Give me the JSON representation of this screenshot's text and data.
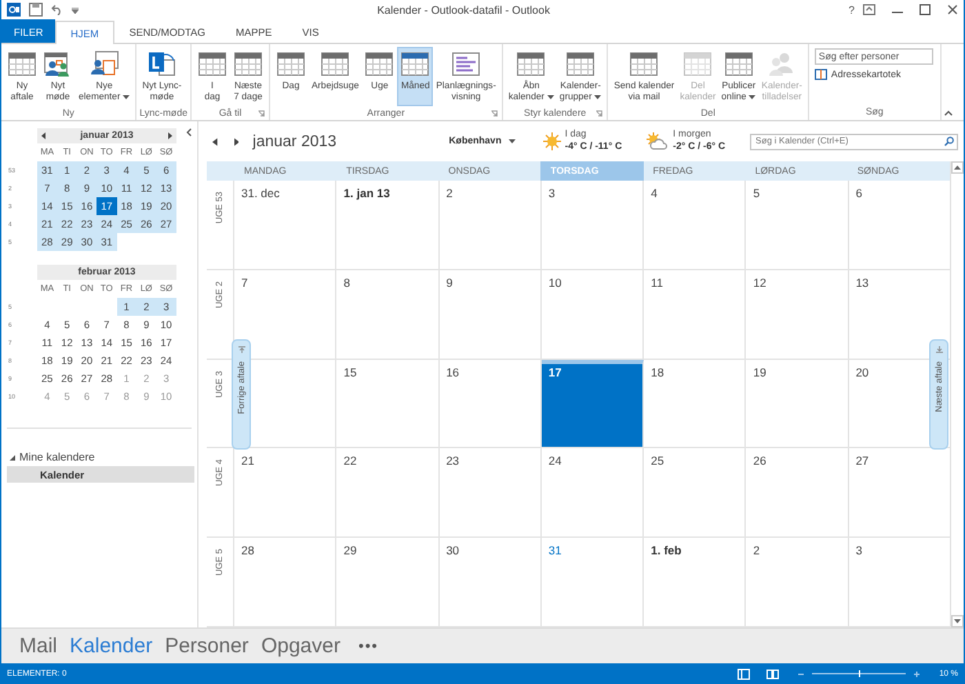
{
  "window": {
    "title": "Kalender - Outlook-datafil - Outlook",
    "help": "?"
  },
  "ribbon_tabs": [
    {
      "label": "FILER",
      "kind": "file",
      "selected": false
    },
    {
      "label": "HJEM",
      "kind": "tab",
      "selected": true
    },
    {
      "label": "SEND/MODTAG",
      "kind": "tab",
      "selected": false
    },
    {
      "label": "MAPPE",
      "kind": "tab",
      "selected": false
    },
    {
      "label": "VIS",
      "kind": "tab",
      "selected": false
    }
  ],
  "ribbon_groups": [
    {
      "label": "Ny",
      "launcher": false,
      "buttons": [
        {
          "lines": [
            "Ny",
            "aftale"
          ],
          "dropdown": false,
          "selected": false,
          "disabled": false
        },
        {
          "lines": [
            "Nyt",
            "møde"
          ],
          "dropdown": false,
          "selected": false,
          "disabled": false
        },
        {
          "lines": [
            "Nye",
            "elementer"
          ],
          "dropdown": true,
          "selected": false,
          "disabled": false
        }
      ]
    },
    {
      "label": "Lync-møde",
      "launcher": false,
      "buttons": [
        {
          "lines": [
            "Nyt Lync-",
            "møde"
          ],
          "dropdown": false,
          "selected": false,
          "disabled": false
        }
      ]
    },
    {
      "label": "Gå til",
      "launcher": true,
      "buttons": [
        {
          "lines": [
            "I",
            "dag"
          ],
          "dropdown": false,
          "selected": false,
          "disabled": false
        },
        {
          "lines": [
            "Næste",
            "7 dage"
          ],
          "dropdown": false,
          "selected": false,
          "disabled": false
        }
      ]
    },
    {
      "label": "Arranger",
      "launcher": true,
      "buttons": [
        {
          "lines": [
            "Dag"
          ],
          "dropdown": false,
          "selected": false,
          "disabled": false
        },
        {
          "lines": [
            "Arbejdsuge"
          ],
          "dropdown": false,
          "selected": false,
          "disabled": false
        },
        {
          "lines": [
            "Uge"
          ],
          "dropdown": false,
          "selected": false,
          "disabled": false
        },
        {
          "lines": [
            "Måned"
          ],
          "dropdown": false,
          "selected": true,
          "disabled": false
        },
        {
          "lines": [
            "Planlægnings-",
            "visning"
          ],
          "dropdown": false,
          "selected": false,
          "disabled": false
        }
      ]
    },
    {
      "label": "Styr kalendere",
      "launcher": true,
      "buttons": [
        {
          "lines": [
            "Åbn",
            "kalender"
          ],
          "dropdown": true,
          "selected": false,
          "disabled": false
        },
        {
          "lines": [
            "Kalender-",
            "grupper"
          ],
          "dropdown": true,
          "selected": false,
          "disabled": false
        }
      ]
    },
    {
      "label": "Del",
      "launcher": false,
      "buttons": [
        {
          "lines": [
            "Send kalender",
            "via mail"
          ],
          "dropdown": false,
          "selected": false,
          "disabled": false
        },
        {
          "lines": [
            "Del",
            "kalender"
          ],
          "dropdown": false,
          "selected": false,
          "disabled": true
        },
        {
          "lines": [
            "Publicer",
            "online"
          ],
          "dropdown": true,
          "selected": false,
          "disabled": false
        },
        {
          "lines": [
            "Kalender-",
            "tilladelser"
          ],
          "dropdown": false,
          "selected": false,
          "disabled": true
        }
      ]
    }
  ],
  "search_group": {
    "label": "Søg",
    "placeholder": "Søg efter personer",
    "address_book": "Adressekartotek"
  },
  "mini_calendars": [
    {
      "title": "januar 2013",
      "arrows": true,
      "weekdays": [
        "MA",
        "TI",
        "ON",
        "TO",
        "FR",
        "LØ",
        "SØ"
      ],
      "weeks": [
        {
          "number": "53",
          "days": [
            {
              "label": "31",
              "in_view": true,
              "today": false,
              "dim": false
            },
            {
              "label": "1",
              "in_view": true,
              "today": false,
              "dim": false
            },
            {
              "label": "2",
              "in_view": true,
              "today": false,
              "dim": false
            },
            {
              "label": "3",
              "in_view": true,
              "today": false,
              "dim": false
            },
            {
              "label": "4",
              "in_view": true,
              "today": false,
              "dim": false
            },
            {
              "label": "5",
              "in_view": true,
              "today": false,
              "dim": false
            },
            {
              "label": "6",
              "in_view": true,
              "today": false,
              "dim": false
            }
          ]
        },
        {
          "number": "2",
          "days": [
            {
              "label": "7",
              "in_view": true,
              "today": false,
              "dim": false
            },
            {
              "label": "8",
              "in_view": true,
              "today": false,
              "dim": false
            },
            {
              "label": "9",
              "in_view": true,
              "today": false,
              "dim": false
            },
            {
              "label": "10",
              "in_view": true,
              "today": false,
              "dim": false
            },
            {
              "label": "11",
              "in_view": true,
              "today": false,
              "dim": false
            },
            {
              "label": "12",
              "in_view": true,
              "today": false,
              "dim": false
            },
            {
              "label": "13",
              "in_view": true,
              "today": false,
              "dim": false
            }
          ]
        },
        {
          "number": "3",
          "days": [
            {
              "label": "14",
              "in_view": true,
              "today": false,
              "dim": false
            },
            {
              "label": "15",
              "in_view": true,
              "today": false,
              "dim": false
            },
            {
              "label": "16",
              "in_view": true,
              "today": false,
              "dim": false
            },
            {
              "label": "17",
              "in_view": true,
              "today": true,
              "dim": false
            },
            {
              "label": "18",
              "in_view": true,
              "today": false,
              "dim": false
            },
            {
              "label": "19",
              "in_view": true,
              "today": false,
              "dim": false
            },
            {
              "label": "20",
              "in_view": true,
              "today": false,
              "dim": false
            }
          ]
        },
        {
          "number": "4",
          "days": [
            {
              "label": "21",
              "in_view": true,
              "today": false,
              "dim": false
            },
            {
              "label": "22",
              "in_view": true,
              "today": false,
              "dim": false
            },
            {
              "label": "23",
              "in_view": true,
              "today": false,
              "dim": false
            },
            {
              "label": "24",
              "in_view": true,
              "today": false,
              "dim": false
            },
            {
              "label": "25",
              "in_view": true,
              "today": false,
              "dim": false
            },
            {
              "label": "26",
              "in_view": true,
              "today": false,
              "dim": false
            },
            {
              "label": "27",
              "in_view": true,
              "today": false,
              "dim": false
            }
          ]
        },
        {
          "number": "5",
          "days": [
            {
              "label": "28",
              "in_view": true,
              "today": false,
              "dim": false
            },
            {
              "label": "29",
              "in_view": true,
              "today": false,
              "dim": false
            },
            {
              "label": "30",
              "in_view": true,
              "today": false,
              "dim": false
            },
            {
              "label": "31",
              "in_view": true,
              "today": false,
              "dim": false
            }
          ]
        }
      ]
    },
    {
      "title": "februar 2013",
      "arrows": false,
      "weekdays": [
        "MA",
        "TI",
        "ON",
        "TO",
        "FR",
        "LØ",
        "SØ"
      ],
      "weeks": [
        {
          "number": "5",
          "days": [
            {
              "label": "1",
              "in_view": true,
              "today": false,
              "dim": false
            },
            {
              "label": "2",
              "in_view": true,
              "today": false,
              "dim": false
            },
            {
              "label": "3",
              "in_view": true,
              "today": false,
              "dim": false
            }
          ]
        },
        {
          "number": "6",
          "days": [
            {
              "label": "4",
              "in_view": false,
              "today": false,
              "dim": false
            },
            {
              "label": "5",
              "in_view": false,
              "today": false,
              "dim": false
            },
            {
              "label": "6",
              "in_view": false,
              "today": false,
              "dim": false
            },
            {
              "label": "7",
              "in_view": false,
              "today": false,
              "dim": false
            },
            {
              "label": "8",
              "in_view": false,
              "today": false,
              "dim": false
            },
            {
              "label": "9",
              "in_view": false,
              "today": false,
              "dim": false
            },
            {
              "label": "10",
              "in_view": false,
              "today": false,
              "dim": false
            }
          ]
        },
        {
          "number": "7",
          "days": [
            {
              "label": "11",
              "in_view": false,
              "today": false,
              "dim": false
            },
            {
              "label": "12",
              "in_view": false,
              "today": false,
              "dim": false
            },
            {
              "label": "13",
              "in_view": false,
              "today": false,
              "dim": false
            },
            {
              "label": "14",
              "in_view": false,
              "today": false,
              "dim": false
            },
            {
              "label": "15",
              "in_view": false,
              "today": false,
              "dim": false
            },
            {
              "label": "16",
              "in_view": false,
              "today": false,
              "dim": false
            },
            {
              "label": "17",
              "in_view": false,
              "today": false,
              "dim": false
            }
          ]
        },
        {
          "number": "8",
          "days": [
            {
              "label": "18",
              "in_view": false,
              "today": false,
              "dim": false
            },
            {
              "label": "19",
              "in_view": false,
              "today": false,
              "dim": false
            },
            {
              "label": "20",
              "in_view": false,
              "today": false,
              "dim": false
            },
            {
              "label": "21",
              "in_view": false,
              "today": false,
              "dim": false
            },
            {
              "label": "22",
              "in_view": false,
              "today": false,
              "dim": false
            },
            {
              "label": "23",
              "in_view": false,
              "today": false,
              "dim": false
            },
            {
              "label": "24",
              "in_view": false,
              "today": false,
              "dim": false
            }
          ]
        },
        {
          "number": "9",
          "days": [
            {
              "label": "25",
              "in_view": false,
              "today": false,
              "dim": false
            },
            {
              "label": "26",
              "in_view": false,
              "today": false,
              "dim": false
            },
            {
              "label": "27",
              "in_view": false,
              "today": false,
              "dim": false
            },
            {
              "label": "28",
              "in_view": false,
              "today": false,
              "dim": false
            },
            {
              "label": "1",
              "in_view": false,
              "today": false,
              "dim": true
            },
            {
              "label": "2",
              "in_view": false,
              "today": false,
              "dim": true
            },
            {
              "label": "3",
              "in_view": false,
              "today": false,
              "dim": true
            }
          ]
        },
        {
          "number": "10",
          "days": [
            {
              "label": "4",
              "in_view": false,
              "today": false,
              "dim": true
            },
            {
              "label": "5",
              "in_view": false,
              "today": false,
              "dim": true
            },
            {
              "label": "6",
              "in_view": false,
              "today": false,
              "dim": true
            },
            {
              "label": "7",
              "in_view": false,
              "today": false,
              "dim": true
            },
            {
              "label": "8",
              "in_view": false,
              "today": false,
              "dim": true
            },
            {
              "label": "9",
              "in_view": false,
              "today": false,
              "dim": true
            },
            {
              "label": "10",
              "in_view": false,
              "today": false,
              "dim": true
            }
          ]
        }
      ]
    }
  ],
  "folder_pane": {
    "section": "Mine kalendere",
    "expanded": true,
    "items": [
      {
        "label": "Kalender",
        "selected": true
      }
    ]
  },
  "calendar": {
    "title": "januar 2013",
    "location": "København",
    "weather": [
      {
        "label": "I dag",
        "temps": "-4° C / -11° C",
        "kind": "sun"
      },
      {
        "label": "I morgen",
        "temps": "-2° C / -6° C",
        "kind": "partly_cloudy"
      }
    ],
    "search_placeholder": "Søg i Kalender (Ctrl+E)",
    "weekdays": [
      {
        "label": "MANDAG",
        "selected": false
      },
      {
        "label": "TIRSDAG",
        "selected": false
      },
      {
        "label": "ONSDAG",
        "selected": false
      },
      {
        "label": "TORSDAG",
        "selected": true
      },
      {
        "label": "FREDAG",
        "selected": false
      },
      {
        "label": "LØRDAG",
        "selected": false
      },
      {
        "label": "SØNDAG",
        "selected": false
      }
    ],
    "weeks": [
      {
        "label": "UGE 53",
        "days": [
          {
            "label": "31. dec",
            "bold": false,
            "today": false,
            "accent": false
          },
          {
            "label": "1. jan 13",
            "bold": true,
            "today": false,
            "accent": false
          },
          {
            "label": "2",
            "bold": false,
            "today": false,
            "accent": false
          },
          {
            "label": "3",
            "bold": false,
            "today": false,
            "accent": false
          },
          {
            "label": "4",
            "bold": false,
            "today": false,
            "accent": false
          },
          {
            "label": "5",
            "bold": false,
            "today": false,
            "accent": false
          },
          {
            "label": "6",
            "bold": false,
            "today": false,
            "accent": false
          }
        ]
      },
      {
        "label": "UGE 2",
        "days": [
          {
            "label": "7",
            "bold": false,
            "today": false,
            "accent": false
          },
          {
            "label": "8",
            "bold": false,
            "today": false,
            "accent": false
          },
          {
            "label": "9",
            "bold": false,
            "today": false,
            "accent": false
          },
          {
            "label": "10",
            "bold": false,
            "today": false,
            "accent": false
          },
          {
            "label": "11",
            "bold": false,
            "today": false,
            "accent": false
          },
          {
            "label": "12",
            "bold": false,
            "today": false,
            "accent": false
          },
          {
            "label": "13",
            "bold": false,
            "today": false,
            "accent": false
          }
        ]
      },
      {
        "label": "UGE 3",
        "days": [
          {
            "label": "15",
            "bold": false,
            "today": false,
            "accent": false
          },
          {
            "label": "16",
            "bold": false,
            "today": false,
            "accent": false
          },
          {
            "label": "17",
            "bold": true,
            "today": true,
            "accent": false
          },
          {
            "label": "18",
            "bold": false,
            "today": false,
            "accent": false
          },
          {
            "label": "19",
            "bold": false,
            "today": false,
            "accent": false
          },
          {
            "label": "20",
            "bold": false,
            "today": false,
            "accent": false
          }
        ]
      },
      {
        "label": "UGE 4",
        "days": [
          {
            "label": "21",
            "bold": false,
            "today": false,
            "accent": false
          },
          {
            "label": "22",
            "bold": false,
            "today": false,
            "accent": false
          },
          {
            "label": "23",
            "bold": false,
            "today": false,
            "accent": false
          },
          {
            "label": "24",
            "bold": false,
            "today": false,
            "accent": false
          },
          {
            "label": "25",
            "bold": false,
            "today": false,
            "accent": false
          },
          {
            "label": "26",
            "bold": false,
            "today": false,
            "accent": false
          },
          {
            "label": "27",
            "bold": false,
            "today": false,
            "accent": false
          }
        ]
      },
      {
        "label": "UGE 5",
        "days": [
          {
            "label": "28",
            "bold": false,
            "today": false,
            "accent": false
          },
          {
            "label": "29",
            "bold": false,
            "today": false,
            "accent": false
          },
          {
            "label": "30",
            "bold": false,
            "today": false,
            "accent": false
          },
          {
            "label": "31",
            "bold": false,
            "today": false,
            "accent": true
          },
          {
            "label": "1. feb",
            "bold": true,
            "today": false,
            "accent": false
          },
          {
            "label": "2",
            "bold": false,
            "today": false,
            "accent": false
          },
          {
            "label": "3",
            "bold": false,
            "today": false,
            "accent": false
          }
        ]
      }
    ],
    "prev_appointment": "Forrige aftale",
    "next_appointment": "Næste aftale"
  },
  "navigation": [
    {
      "label": "Mail",
      "selected": false
    },
    {
      "label": "Kalender",
      "selected": true
    },
    {
      "label": "Personer",
      "selected": false
    },
    {
      "label": "Opgaver",
      "selected": false
    }
  ],
  "navigation_more": "•••",
  "status_bar": {
    "items": "ELEMENTER: 0",
    "zoom_slider": {
      "level": 0.5
    },
    "zoom_text": "10 %"
  }
}
